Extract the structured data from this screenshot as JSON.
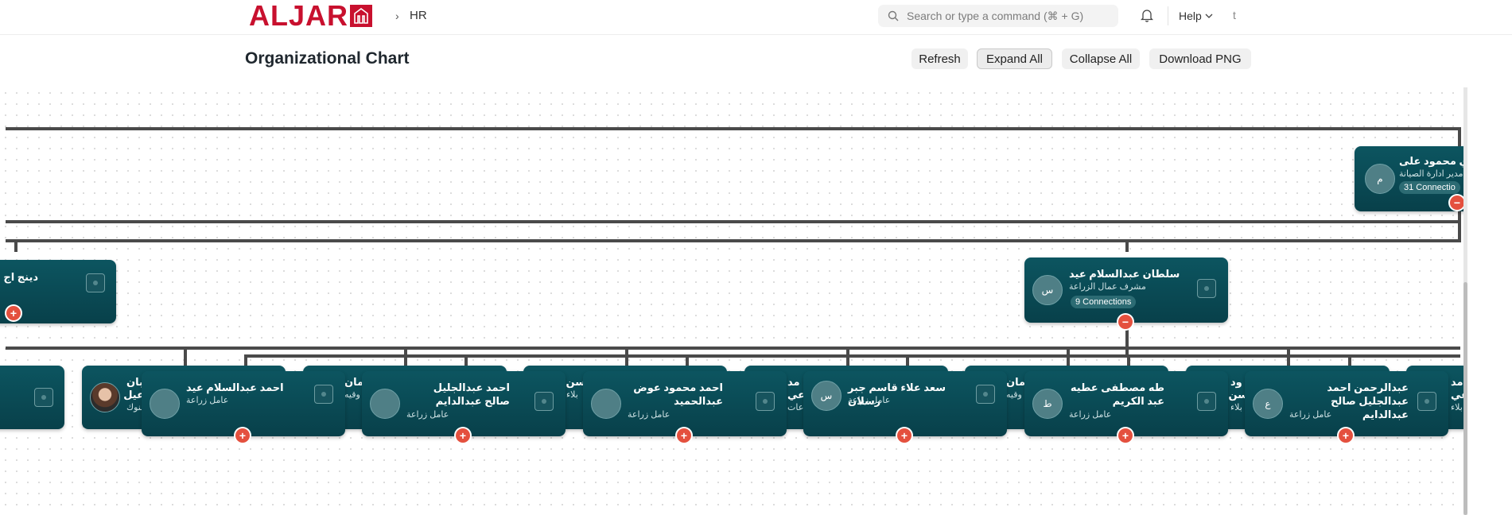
{
  "navbar": {
    "logo_text": "ALJAR",
    "breadcrumb": "HR",
    "breadcrumb_sep": "›",
    "search_placeholder": "Search or type a command (⌘ + G)",
    "help_label": "Help",
    "user_initial": "t"
  },
  "page": {
    "title": "Organizational Chart",
    "buttons": {
      "refresh": "Refresh",
      "expand": "Expand All",
      "collapse": "Collapse All",
      "download": "Download PNG"
    }
  },
  "nodes": {
    "top_right": {
      "name": "ي محمود على",
      "role": "مدير ادارة الصيانة",
      "connections": "31 Connectio",
      "avatar": "م",
      "toggle": "−"
    },
    "left_mid": {
      "name": "دينج اج",
      "toggle": "+"
    },
    "supervisor": {
      "name": "سلطان عبدالسلام عيد",
      "role": "مشرف عمال الزراعة",
      "connections": "9 Connections",
      "avatar": "س",
      "toggle": "−"
    },
    "workers": [
      {
        "name": "احمد عبدالسلام عيد",
        "role": "عامل زراعة",
        "avatar": "",
        "toggle": "+"
      },
      {
        "name": "احمد عبدالجليل صالح عبدالدايم",
        "role": "عامل زراعة",
        "avatar": "",
        "toggle": "+"
      },
      {
        "name": "احمد محمود عوض عبدالحميد",
        "role": "عامل زراعة",
        "avatar": "",
        "toggle": "+"
      },
      {
        "name": "سعد علاء قاسم جبر رسلان",
        "role": "عامل زراعة",
        "avatar": "س",
        "toggle": "+"
      },
      {
        "name": "طه مصطفى عطيه عبد الكريم",
        "role": "عامل زراعة",
        "avatar": "ط",
        "toggle": "+"
      },
      {
        "name": "عبدالرحمن احمد عبدالجليل صالح عبدالدايم",
        "role": "عامل زراعة",
        "avatar": "ع",
        "toggle": "+"
      }
    ],
    "behind": [
      {
        "name": "بان",
        "name2": "عيل",
        "role": "بنوك"
      },
      {
        "name": "مان",
        "role": "وقيه"
      },
      {
        "name": "سن",
        "role": "بلاء"
      },
      {
        "name": "مد",
        "name2": "عي",
        "role": "عات"
      },
      {
        "name": "مان",
        "role": "وقيه"
      },
      {
        "name": "ود",
        "name2": "سن",
        "role": "بلاء"
      },
      {
        "name": "مد",
        "name2": "عي",
        "role": "بلاء"
      }
    ]
  },
  "colors": {
    "brand": "#c8102e",
    "node": "#0a4a54",
    "toggle": "#e4503e",
    "connector": "#4a4a4a"
  }
}
